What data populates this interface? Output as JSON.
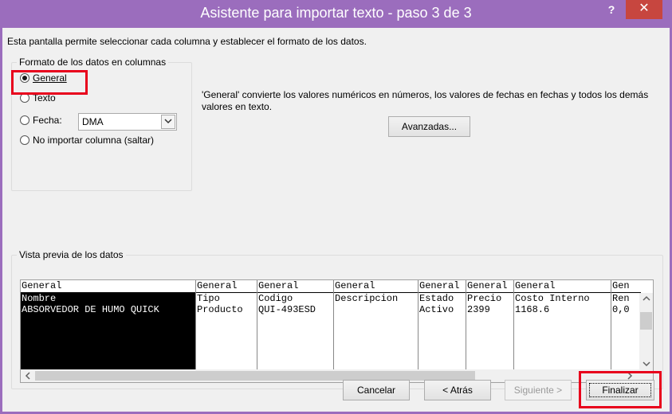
{
  "window": {
    "title": "Asistente para importar texto - paso 3 de 3",
    "help_label": "?",
    "close_label": "✕"
  },
  "description": "Esta pantalla permite seleccionar cada columna y establecer el formato de los datos.",
  "format_group": {
    "legend": "Formato de los datos en columnas",
    "options": [
      {
        "label": "General",
        "selected": true
      },
      {
        "label": "Texto",
        "selected": false
      },
      {
        "label": "Fecha:",
        "selected": false
      },
      {
        "label": "No importar columna (saltar)",
        "selected": false
      }
    ],
    "date_format": "DMA",
    "dropdown_icon": "chevron-down"
  },
  "info_text": "'General' convierte los valores numéricos en números, los valores de fechas en fechas y todos los demás valores en texto.",
  "advanced_button": "Avanzadas...",
  "preview": {
    "legend": "Vista previa de los datos",
    "columns": [
      {
        "header": "General",
        "cells": [
          "Nombre",
          "ABSORVEDOR DE HUMO QUICK"
        ]
      },
      {
        "header": "General",
        "cells": [
          "Tipo",
          "Producto"
        ]
      },
      {
        "header": "General",
        "cells": [
          "Codigo",
          "QUI-493ESD"
        ]
      },
      {
        "header": "General",
        "cells": [
          "Descripcion",
          ""
        ]
      },
      {
        "header": "General",
        "cells": [
          "Estado",
          "Activo"
        ]
      },
      {
        "header": "General",
        "cells": [
          "Precio",
          "2399"
        ]
      },
      {
        "header": "General",
        "cells": [
          "Costo Interno",
          "1168.6"
        ]
      },
      {
        "header": "Gen",
        "cells": [
          "Ren",
          "0,0"
        ]
      }
    ],
    "scroll_left": "<",
    "scroll_right": ">",
    "scroll_up": "^",
    "scroll_down": "v"
  },
  "buttons": {
    "cancel": "Cancelar",
    "back": "< Atrás",
    "next": "Siguiente >",
    "finish": "Finalizar"
  },
  "colors": {
    "titlebar": "#9b6dbd",
    "close": "#c7463f",
    "highlight": "#e8001c"
  }
}
